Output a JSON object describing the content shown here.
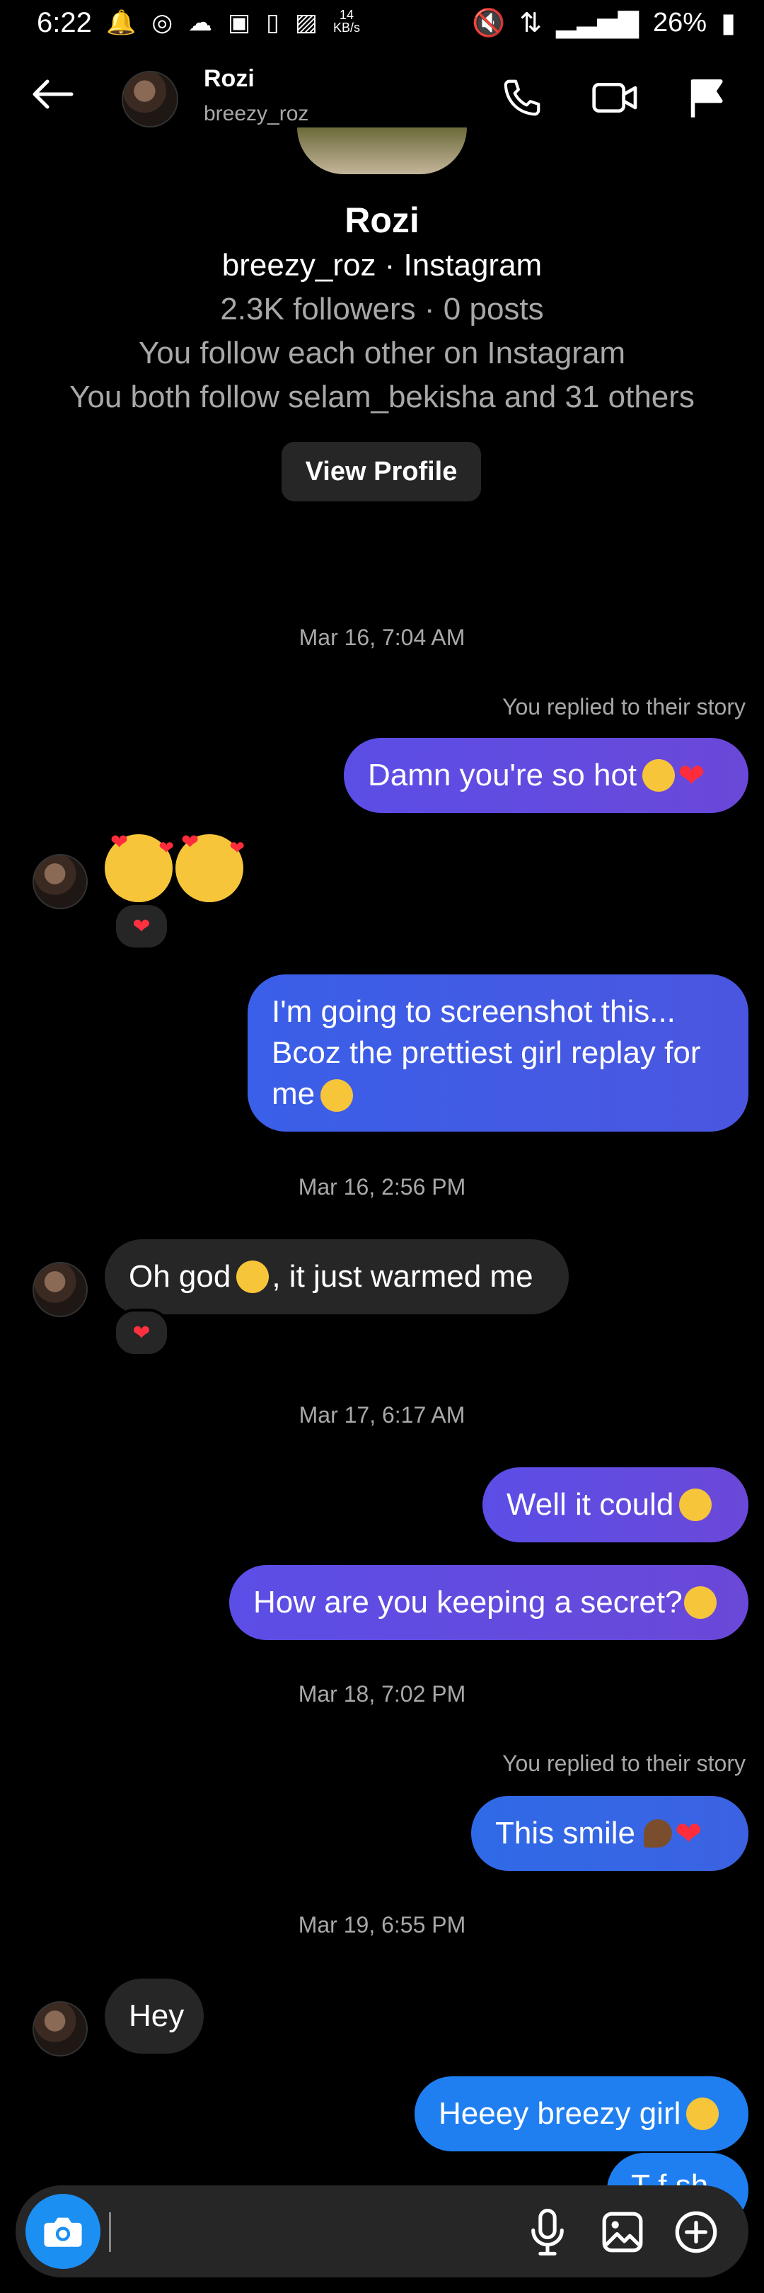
{
  "status_bar": {
    "time": "6:22",
    "speed_value": "14",
    "speed_unit": "KB/s",
    "battery": "26%"
  },
  "header": {
    "name": "Rozi",
    "username": "breezy_roz"
  },
  "profile": {
    "name": "Rozi",
    "subtitle": "breezy_roz · Instagram",
    "stats": "2.3K followers · 0 posts",
    "mutual": "You follow each other on Instagram",
    "both_follow": "You both follow selam_bekisha and 31 others",
    "view_profile_label": "View Profile"
  },
  "messages": {
    "ts1": "Mar 16, 7:04 AM",
    "reply_note1": "You replied to their story",
    "m1": "Damn you're so hot",
    "m3_line1": "I'm going to screenshot this...",
    "m3_line2": "Bcoz the prettiest girl replay for",
    "m3_line3": "me",
    "ts2": "Mar 16, 2:56 PM",
    "m4_a": "Oh god",
    "m4_b": ", it just warmed me",
    "ts3": "Mar 17, 6:17 AM",
    "m5": "Well it could",
    "m6": "How are you keeping a secret?",
    "ts4": "Mar 18, 7:02 PM",
    "reply_note2": "You replied to their story",
    "m7": "This smile",
    "ts5": "Mar 19, 6:55 PM",
    "m8": "Hey",
    "m9": "Heeey breezy girl",
    "m10_partial": "T  f  sh"
  },
  "colors": {
    "outgoing_purple": "#5b4ee6",
    "outgoing_blue": "#1f7ff0",
    "incoming": "#262626",
    "camera_button": "#1c8ff2"
  },
  "icons": {
    "back": "arrow-left-icon",
    "call": "phone-icon",
    "video": "video-camera-icon",
    "report": "flag-icon",
    "camera": "camera-icon",
    "mic": "microphone-icon",
    "gallery": "image-icon",
    "more": "plus-circle-icon"
  }
}
